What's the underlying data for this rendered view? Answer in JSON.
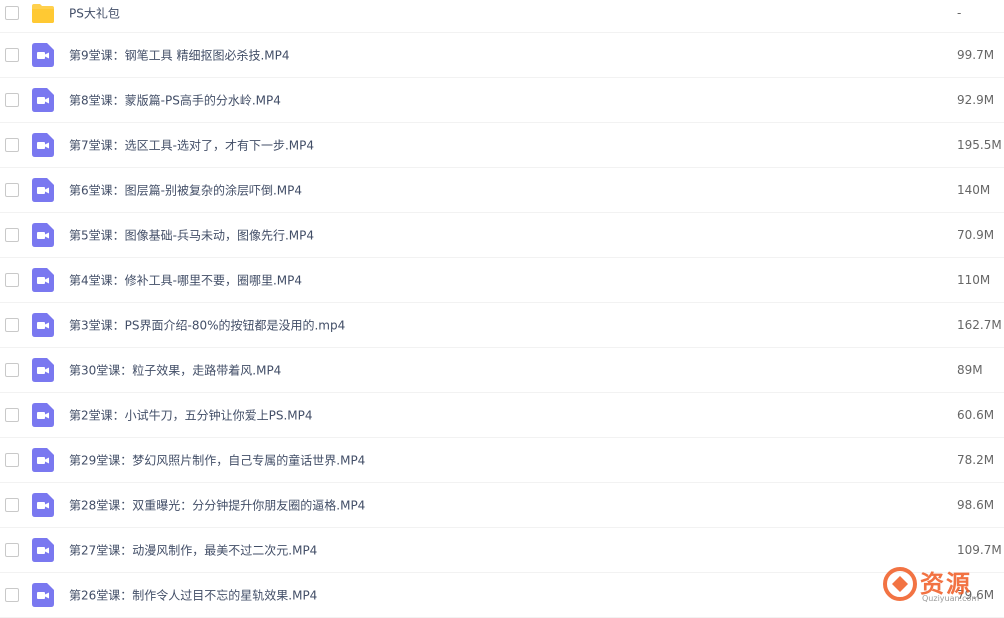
{
  "files": [
    {
      "type": "folder",
      "icon": "folder-icon",
      "name": "PS大礼包",
      "size": "-"
    },
    {
      "type": "video",
      "icon": "video-file-icon",
      "name": "第9堂课：钢笔工具 精细抠图必杀技.MP4",
      "size": "99.7M"
    },
    {
      "type": "video",
      "icon": "video-file-icon",
      "name": "第8堂课：蒙版篇-PS高手的分水岭.MP4",
      "size": "92.9M"
    },
    {
      "type": "video",
      "icon": "video-file-icon",
      "name": "第7堂课：选区工具-选对了，才有下一步.MP4",
      "size": "195.5M"
    },
    {
      "type": "video",
      "icon": "video-file-icon",
      "name": "第6堂课：图层篇-别被复杂的涂层吓倒.MP4",
      "size": "140M"
    },
    {
      "type": "video",
      "icon": "video-file-icon",
      "name": "第5堂课：图像基础-兵马未动，图像先行.MP4",
      "size": "70.9M"
    },
    {
      "type": "video",
      "icon": "video-file-icon",
      "name": "第4堂课：修补工具-哪里不要，圈哪里.MP4",
      "size": "110M"
    },
    {
      "type": "video",
      "icon": "video-file-icon",
      "name": "第3堂课：PS界面介绍-80%的按钮都是没用的.mp4",
      "size": "162.7M"
    },
    {
      "type": "video",
      "icon": "video-file-icon",
      "name": "第30堂课：粒子效果，走路带着风.MP4",
      "size": "89M"
    },
    {
      "type": "video",
      "icon": "video-file-icon",
      "name": "第2堂课：小试牛刀，五分钟让你爱上PS.MP4",
      "size": "60.6M"
    },
    {
      "type": "video",
      "icon": "video-file-icon",
      "name": "第29堂课：梦幻风照片制作，自己专属的童话世界.MP4",
      "size": "78.2M"
    },
    {
      "type": "video",
      "icon": "video-file-icon",
      "name": "第28堂课：双重曝光：分分钟提升你朋友圈的逼格.MP4",
      "size": "98.6M"
    },
    {
      "type": "video",
      "icon": "video-file-icon",
      "name": "第27堂课：动漫风制作，最美不过二次元.MP4",
      "size": "109.7M"
    },
    {
      "type": "video",
      "icon": "video-file-icon",
      "name": "第26堂课：制作令人过目不忘的星轨效果.MP4",
      "size": "79.6M"
    }
  ],
  "watermark": {
    "text": "资源",
    "subtext": "Quziyuan.com",
    "icon": "watermark-logo-icon"
  },
  "colors": {
    "folder": "#ffd04d",
    "video": "#7a78f0",
    "text": "#424e67",
    "watermark": "#f05a22"
  }
}
